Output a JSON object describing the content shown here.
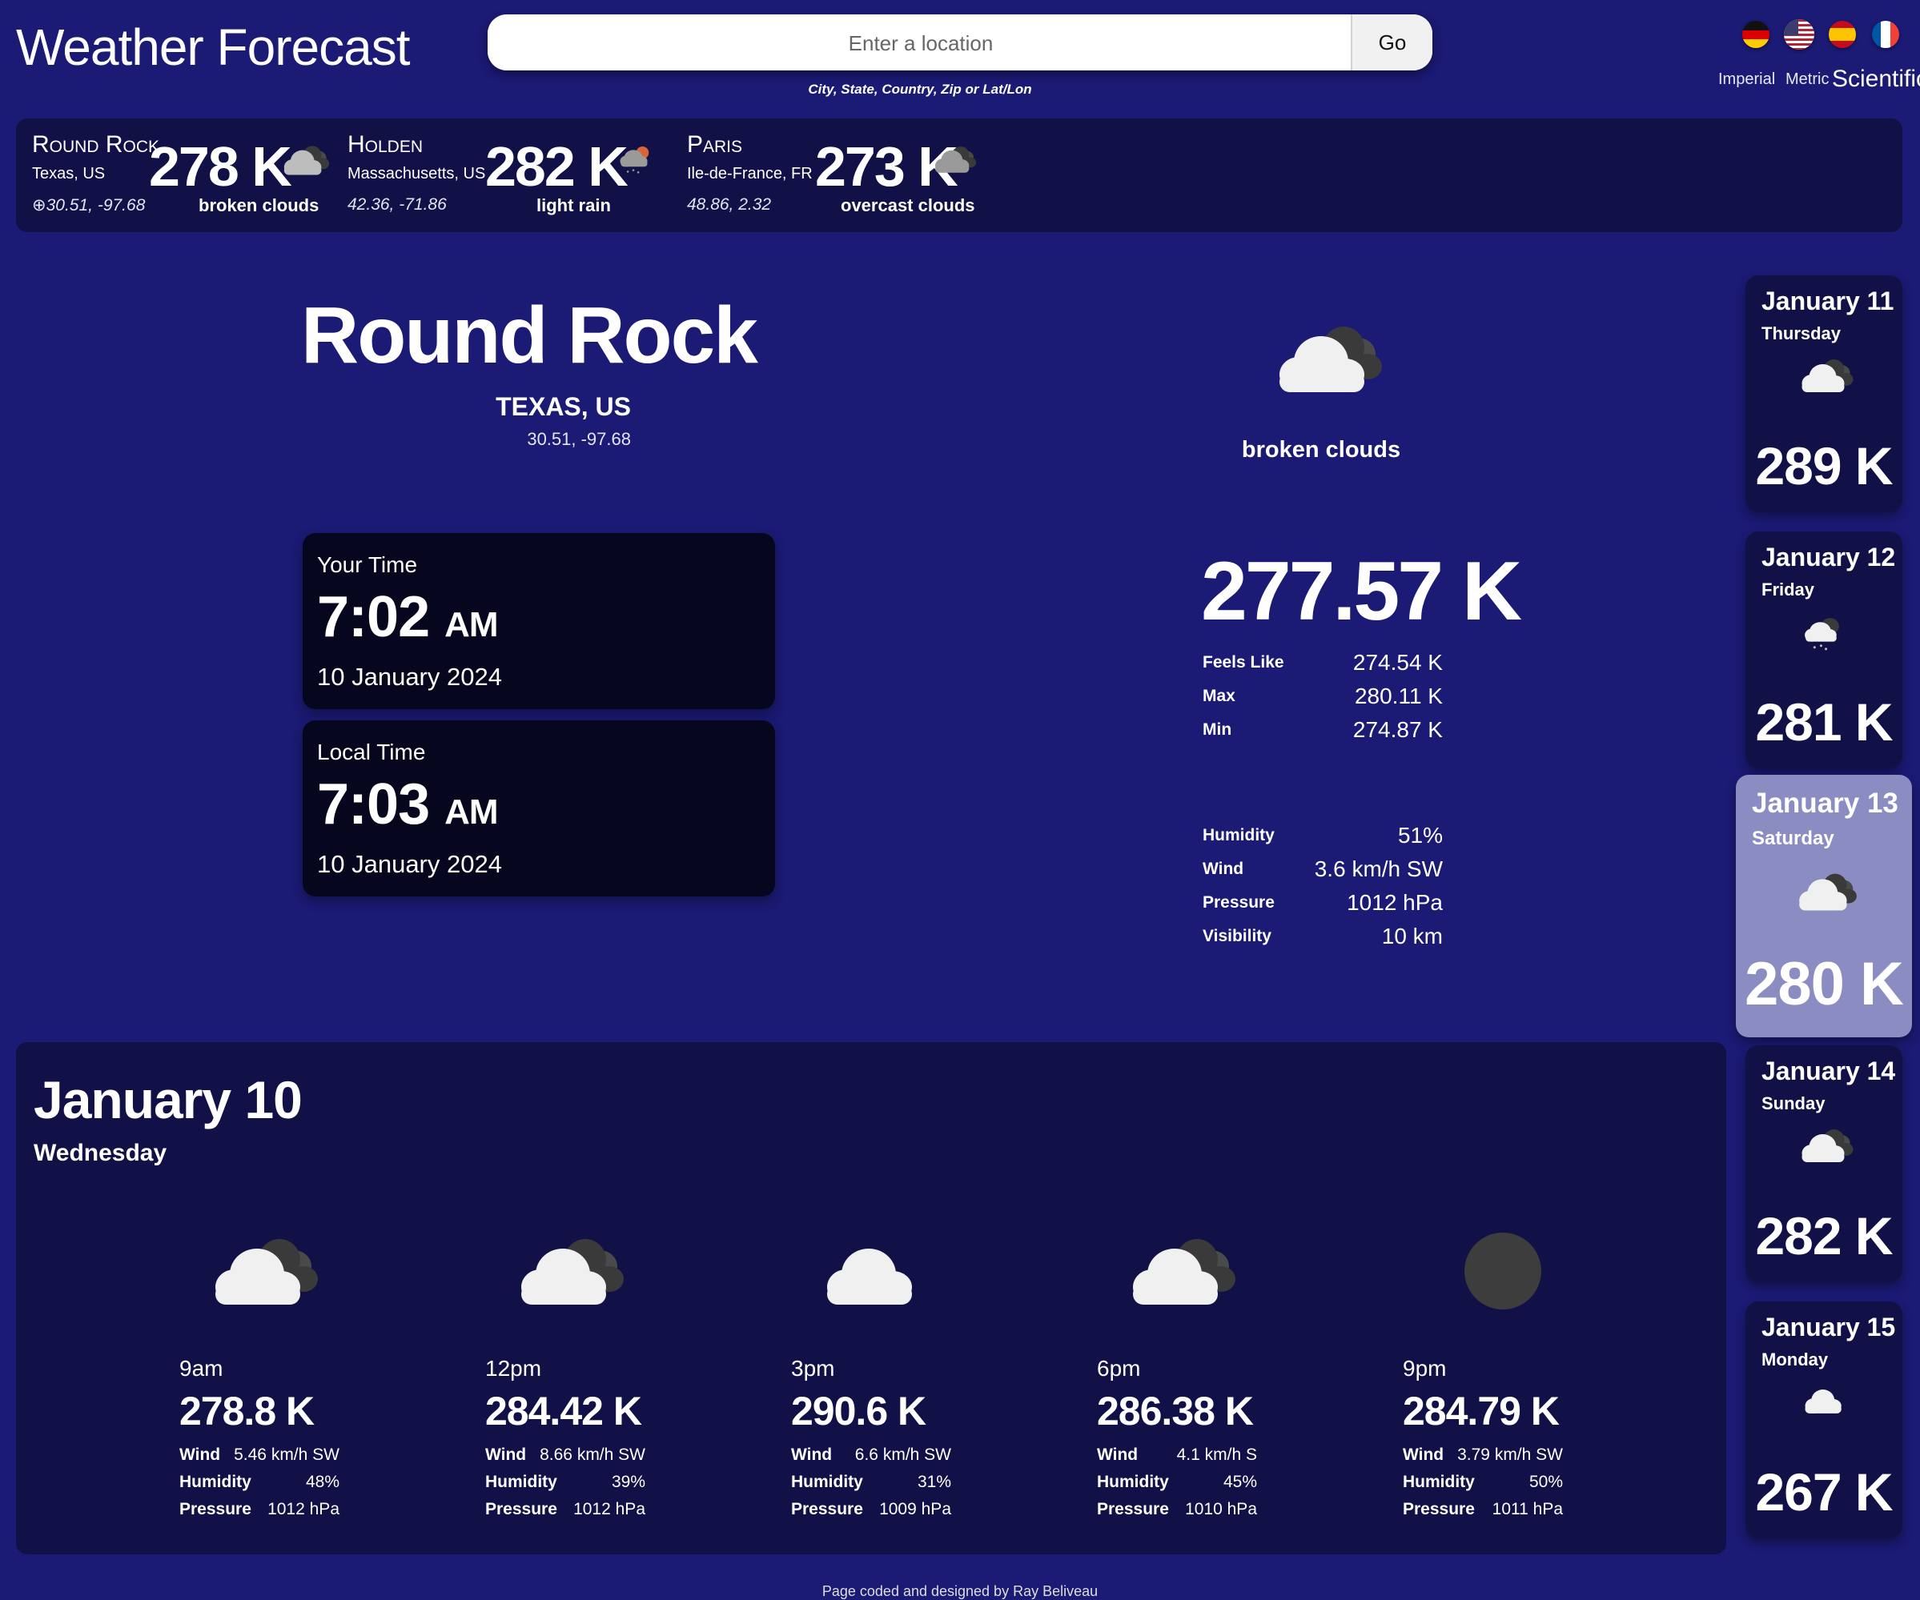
{
  "header": {
    "title": "Weather Forecast",
    "search": {
      "placeholder": "Enter a location",
      "button": "Go",
      "hint": "City, State, Country, Zip or Lat/Lon"
    },
    "languages": [
      "german-flag",
      "us-flag",
      "spanish-flag",
      "french-flag"
    ],
    "units": {
      "imperial": "Imperial",
      "metric": "Metric",
      "scientific": "Scientific",
      "selected": "Scientific"
    }
  },
  "saved_locations": [
    {
      "city": "Round Rock",
      "region": "Texas, US",
      "coords": "30.51, -97.68",
      "temp": "278 K",
      "desc": "broken clouds",
      "icon": "broken-clouds-icon",
      "current": true
    },
    {
      "city": "Holden",
      "region": "Massachusetts, US",
      "coords": "42.36, -71.86",
      "temp": "282 K",
      "desc": "light rain",
      "icon": "light-rain-icon"
    },
    {
      "city": "Paris",
      "region": "Ile-de-France, FR",
      "coords": "48.86, 2.32",
      "temp": "273 K",
      "desc": "overcast clouds",
      "icon": "overcast-clouds-icon"
    }
  ],
  "current": {
    "city": "Round Rock",
    "region": "TEXAS, US",
    "coords": "30.51, -97.68",
    "desc": "broken clouds",
    "temp": "277.57 K",
    "your_time": {
      "label": "Your Time",
      "time": "7:02",
      "ampm": "AM",
      "date": "10 January 2024"
    },
    "local_time": {
      "label": "Local Time",
      "time": "7:03",
      "ampm": "AM",
      "date": "10 January 2024"
    },
    "stats": [
      {
        "key": "Feels Like",
        "value": "274.54 K"
      },
      {
        "key": "Max",
        "value": "280.11 K"
      },
      {
        "key": "Min",
        "value": "274.87 K"
      }
    ],
    "conditions": [
      {
        "key": "Humidity",
        "value": "51%"
      },
      {
        "key": "Wind",
        "value": "3.6 km/h SW"
      },
      {
        "key": "Pressure",
        "value": "1012 hPa"
      },
      {
        "key": "Visibility",
        "value": "10 km"
      }
    ]
  },
  "forecast": [
    {
      "date": "January 11",
      "weekday": "Thursday",
      "temp": "289 K",
      "icon": "broken-clouds-icon"
    },
    {
      "date": "January 12",
      "weekday": "Friday",
      "temp": "281 K",
      "icon": "light-rain-icon"
    },
    {
      "date": "January 13",
      "weekday": "Saturday",
      "temp": "280 K",
      "icon": "broken-clouds-icon",
      "selected": true
    },
    {
      "date": "January 14",
      "weekday": "Sunday",
      "temp": "282 K",
      "icon": "broken-clouds-icon"
    },
    {
      "date": "January 15",
      "weekday": "Monday",
      "temp": "267 K",
      "icon": "cloud-icon"
    }
  ],
  "hourly": {
    "date": "January 10",
    "weekday": "Wednesday",
    "labels": {
      "wind": "Wind",
      "humidity": "Humidity",
      "pressure": "Pressure"
    },
    "hours": [
      {
        "hour": "9am",
        "temp": "278.8 K",
        "wind": "5.46 km/h SW",
        "humidity": "48%",
        "pressure": "1012 hPa",
        "icon": "broken-clouds-icon"
      },
      {
        "hour": "12pm",
        "temp": "284.42 K",
        "wind": "8.66 km/h SW",
        "humidity": "39%",
        "pressure": "1012 hPa",
        "icon": "broken-clouds-icon"
      },
      {
        "hour": "3pm",
        "temp": "290.6 K",
        "wind": "6.6 km/h SW",
        "humidity": "31%",
        "pressure": "1009 hPa",
        "icon": "cloud-icon"
      },
      {
        "hour": "6pm",
        "temp": "286.38 K",
        "wind": "4.1 km/h S",
        "humidity": "45%",
        "pressure": "1010 hPa",
        "icon": "broken-clouds-icon"
      },
      {
        "hour": "9pm",
        "temp": "284.79 K",
        "wind": "3.79 km/h SW",
        "humidity": "50%",
        "pressure": "1011 hPa",
        "icon": "night-clear-icon"
      }
    ]
  },
  "footer": "Page coded and designed by Ray Beliveau",
  "colors": {
    "background": "#1b1a74",
    "panel": "#121147",
    "card": "#06061f",
    "selected_card": "#8a8cc2"
  }
}
